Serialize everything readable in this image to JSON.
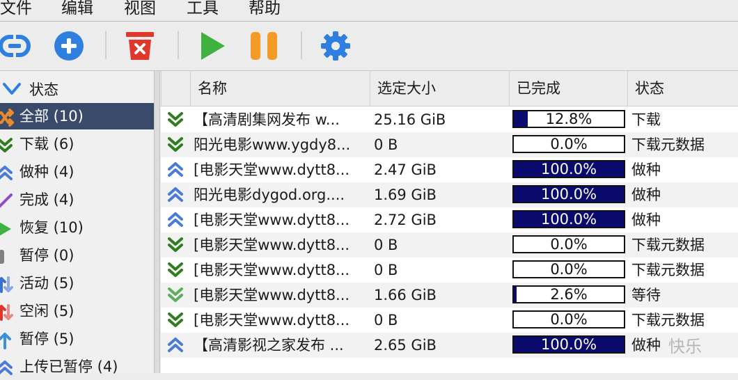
{
  "menu": [
    "文件",
    "编辑",
    "视图",
    "工具",
    "帮助"
  ],
  "toolbar": [
    {
      "name": "add-link-button",
      "icon": "link-icon"
    },
    {
      "name": "add-torrent-button",
      "icon": "plus-circle-icon"
    },
    {
      "name": "delete-button",
      "icon": "trash-x-icon"
    },
    {
      "name": "resume-button",
      "icon": "play-icon"
    },
    {
      "name": "pause-button",
      "icon": "pause-icon"
    },
    {
      "name": "options-button",
      "icon": "gear-icon"
    }
  ],
  "sidebar": {
    "header": "状态",
    "items": [
      {
        "label": "全部 (10)",
        "icon": "shuffle-icon",
        "color": "#e98a2c",
        "selected": true
      },
      {
        "label": "下载 (6)",
        "icon": "download-chevron-icon",
        "color": "#2f7d1f"
      },
      {
        "label": "做种 (4)",
        "icon": "upload-chevron-icon",
        "color": "#4a7bd8"
      },
      {
        "label": "完成 (4)",
        "icon": "check-slash-icon",
        "color": "#8e4ec6"
      },
      {
        "label": "恢复 (10)",
        "icon": "play-icon",
        "color": "#3fb13f"
      },
      {
        "label": "暂停 (0)",
        "icon": "pause-icon",
        "color": "#808080"
      },
      {
        "label": "活动 (5)",
        "icon": "updown-arrows-icon",
        "color": "#3b6fd0"
      },
      {
        "label": "空闲 (5)",
        "icon": "updown-arrows-icon",
        "color": "#e0372a"
      },
      {
        "label": "暂停 (5)",
        "icon": "up-arrow-icon",
        "color": "#3b8ee0"
      },
      {
        "label": "上传已暂停 (4)",
        "icon": "upload-chevron-icon",
        "color": "#4a7bd8"
      }
    ]
  },
  "table": {
    "columns": [
      "名称",
      "选定大小",
      "已完成",
      "状态"
    ],
    "rows": [
      {
        "icon": "download",
        "name": "【高清剧集网发布 w...",
        "size": "25.16 GiB",
        "progress": 0.128,
        "progress_label": "12.8%",
        "status": "下载"
      },
      {
        "icon": "download",
        "name": "阳光电影www.ygdy8...",
        "size": "0 B",
        "progress": 0.0,
        "progress_label": "0.0%",
        "status": "下载元数据"
      },
      {
        "icon": "seed",
        "name": "[电影天堂www.dytt8...",
        "size": "2.47 GiB",
        "progress": 1.0,
        "progress_label": "100.0%",
        "status": "做种"
      },
      {
        "icon": "seed",
        "name": "阳光电影dygod.org....",
        "size": "1.69 GiB",
        "progress": 1.0,
        "progress_label": "100.0%",
        "status": "做种"
      },
      {
        "icon": "seed",
        "name": "[电影天堂www.dytt8...",
        "size": "2.72 GiB",
        "progress": 1.0,
        "progress_label": "100.0%",
        "status": "做种"
      },
      {
        "icon": "download",
        "name": "[电影天堂www.dytt8...",
        "size": "0 B",
        "progress": 0.0,
        "progress_label": "0.0%",
        "status": "下载元数据"
      },
      {
        "icon": "download",
        "name": "[电影天堂www.dytt8...",
        "size": "0 B",
        "progress": 0.0,
        "progress_label": "0.0%",
        "status": "下载元数据"
      },
      {
        "icon": "queued",
        "name": "[电影天堂www.dytt8...",
        "size": "1.66 GiB",
        "progress": 0.026,
        "progress_label": "2.6%",
        "status": "等待"
      },
      {
        "icon": "download",
        "name": "[电影天堂www.dytt8...",
        "size": "0 B",
        "progress": 0.0,
        "progress_label": "0.0%",
        "status": "下载元数据"
      },
      {
        "icon": "seed",
        "name": "【高清影视之家发布 ...",
        "size": "2.65 GiB",
        "progress": 1.0,
        "progress_label": "100.0%",
        "status": "做种"
      }
    ]
  },
  "colors": {
    "download": "#2f7d1f",
    "queued": "#5cae5c",
    "seed": "#4a7bd8",
    "bar_fill": "#0b0b6e",
    "selection": "#3a4a6b"
  },
  "watermark": "快乐"
}
